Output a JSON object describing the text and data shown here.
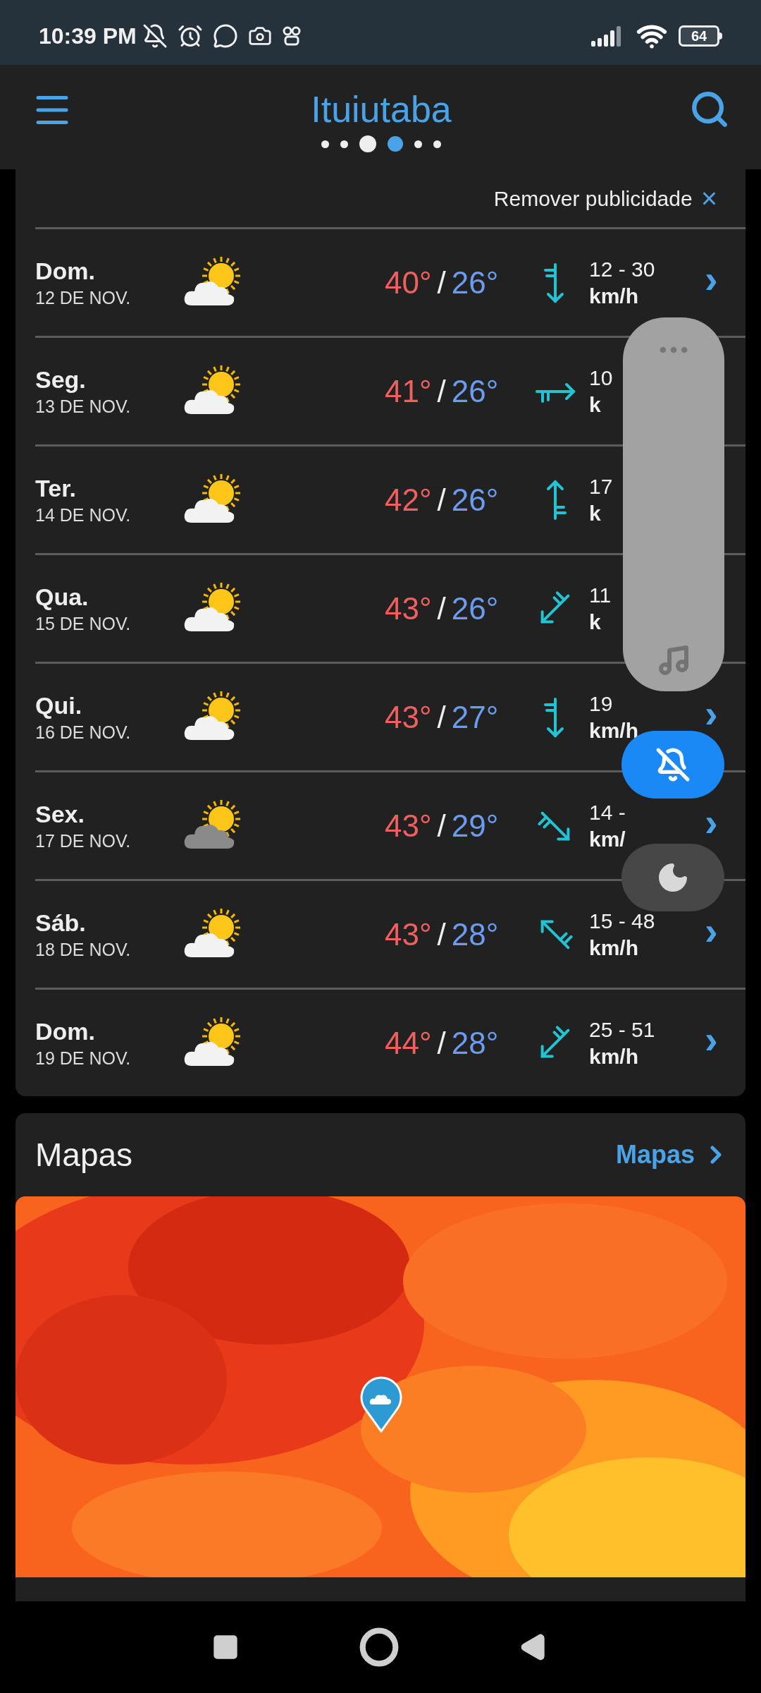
{
  "status_bar": {
    "time": "10:39 PM",
    "battery": "64"
  },
  "app_bar": {
    "title": "Ituiutaba",
    "pages": [
      {
        "kind": "dot",
        "selected": false
      },
      {
        "kind": "dot",
        "selected": false
      },
      {
        "kind": "location",
        "selected": false
      },
      {
        "kind": "dot",
        "selected": true
      },
      {
        "kind": "dot",
        "selected": false
      },
      {
        "kind": "dot",
        "selected": false
      }
    ]
  },
  "forecast": {
    "remove_ads": "Remover publicidade",
    "close": "×",
    "days": [
      {
        "day": "Dom.",
        "date": "12 DE NOV.",
        "icon": {
          "kind": "sunny_cloud"
        },
        "high": "40°",
        "sep": "/",
        "low": "26°",
        "wind": {
          "kind": "south",
          "speed": "12 - 30",
          "unit": "km/h"
        },
        "chevron": "›"
      },
      {
        "day": "Seg.",
        "date": "13 DE NOV.",
        "icon": {
          "kind": "sunny_cloud"
        },
        "high": "41°",
        "sep": "/",
        "low": "26°",
        "wind": {
          "kind": "east",
          "speed": "10",
          "unit": "k"
        }
      },
      {
        "day": "Ter.",
        "date": "14 DE NOV.",
        "icon": {
          "kind": "sunny_cloud"
        },
        "high": "42°",
        "sep": "/",
        "low": "26°",
        "wind": {
          "kind": "north",
          "speed": "17",
          "unit": "k"
        }
      },
      {
        "day": "Qua.",
        "date": "15 DE NOV.",
        "icon": {
          "kind": "sunny_cloud"
        },
        "high": "43°",
        "sep": "/",
        "low": "26°",
        "wind": {
          "kind": "southwest",
          "speed": "11",
          "unit": "k"
        }
      },
      {
        "day": "Qui.",
        "date": "16 DE NOV.",
        "icon": {
          "kind": "sunny_cloud"
        },
        "high": "43°",
        "sep": "/",
        "low": "27°",
        "wind": {
          "kind": "south",
          "speed": "19",
          "unit": "km/h"
        },
        "chevron": "›"
      },
      {
        "day": "Sex.",
        "date": "17 DE NOV.",
        "icon": {
          "kind": "overcast"
        },
        "high": "43°",
        "sep": "/",
        "low": "29°",
        "wind": {
          "kind": "southeast",
          "speed": "14 -",
          "unit": "km/"
        },
        "chevron": "›"
      },
      {
        "day": "Sáb.",
        "date": "18 DE NOV.",
        "icon": {
          "kind": "sunny_cloud"
        },
        "high": "43°",
        "sep": "/",
        "low": "28°",
        "wind": {
          "kind": "northwest",
          "speed": "15 - 48",
          "unit": "km/h"
        },
        "chevron": "›"
      },
      {
        "day": "Dom.",
        "date": "19 DE NOV.",
        "icon": {
          "kind": "sunny_cloud"
        },
        "high": "44°",
        "sep": "/",
        "low": "28°",
        "wind": {
          "kind": "southwest",
          "speed": "25 - 51",
          "unit": "km/h"
        },
        "chevron": "›"
      }
    ]
  },
  "maps": {
    "title": "Mapas",
    "link": "Mapas"
  }
}
